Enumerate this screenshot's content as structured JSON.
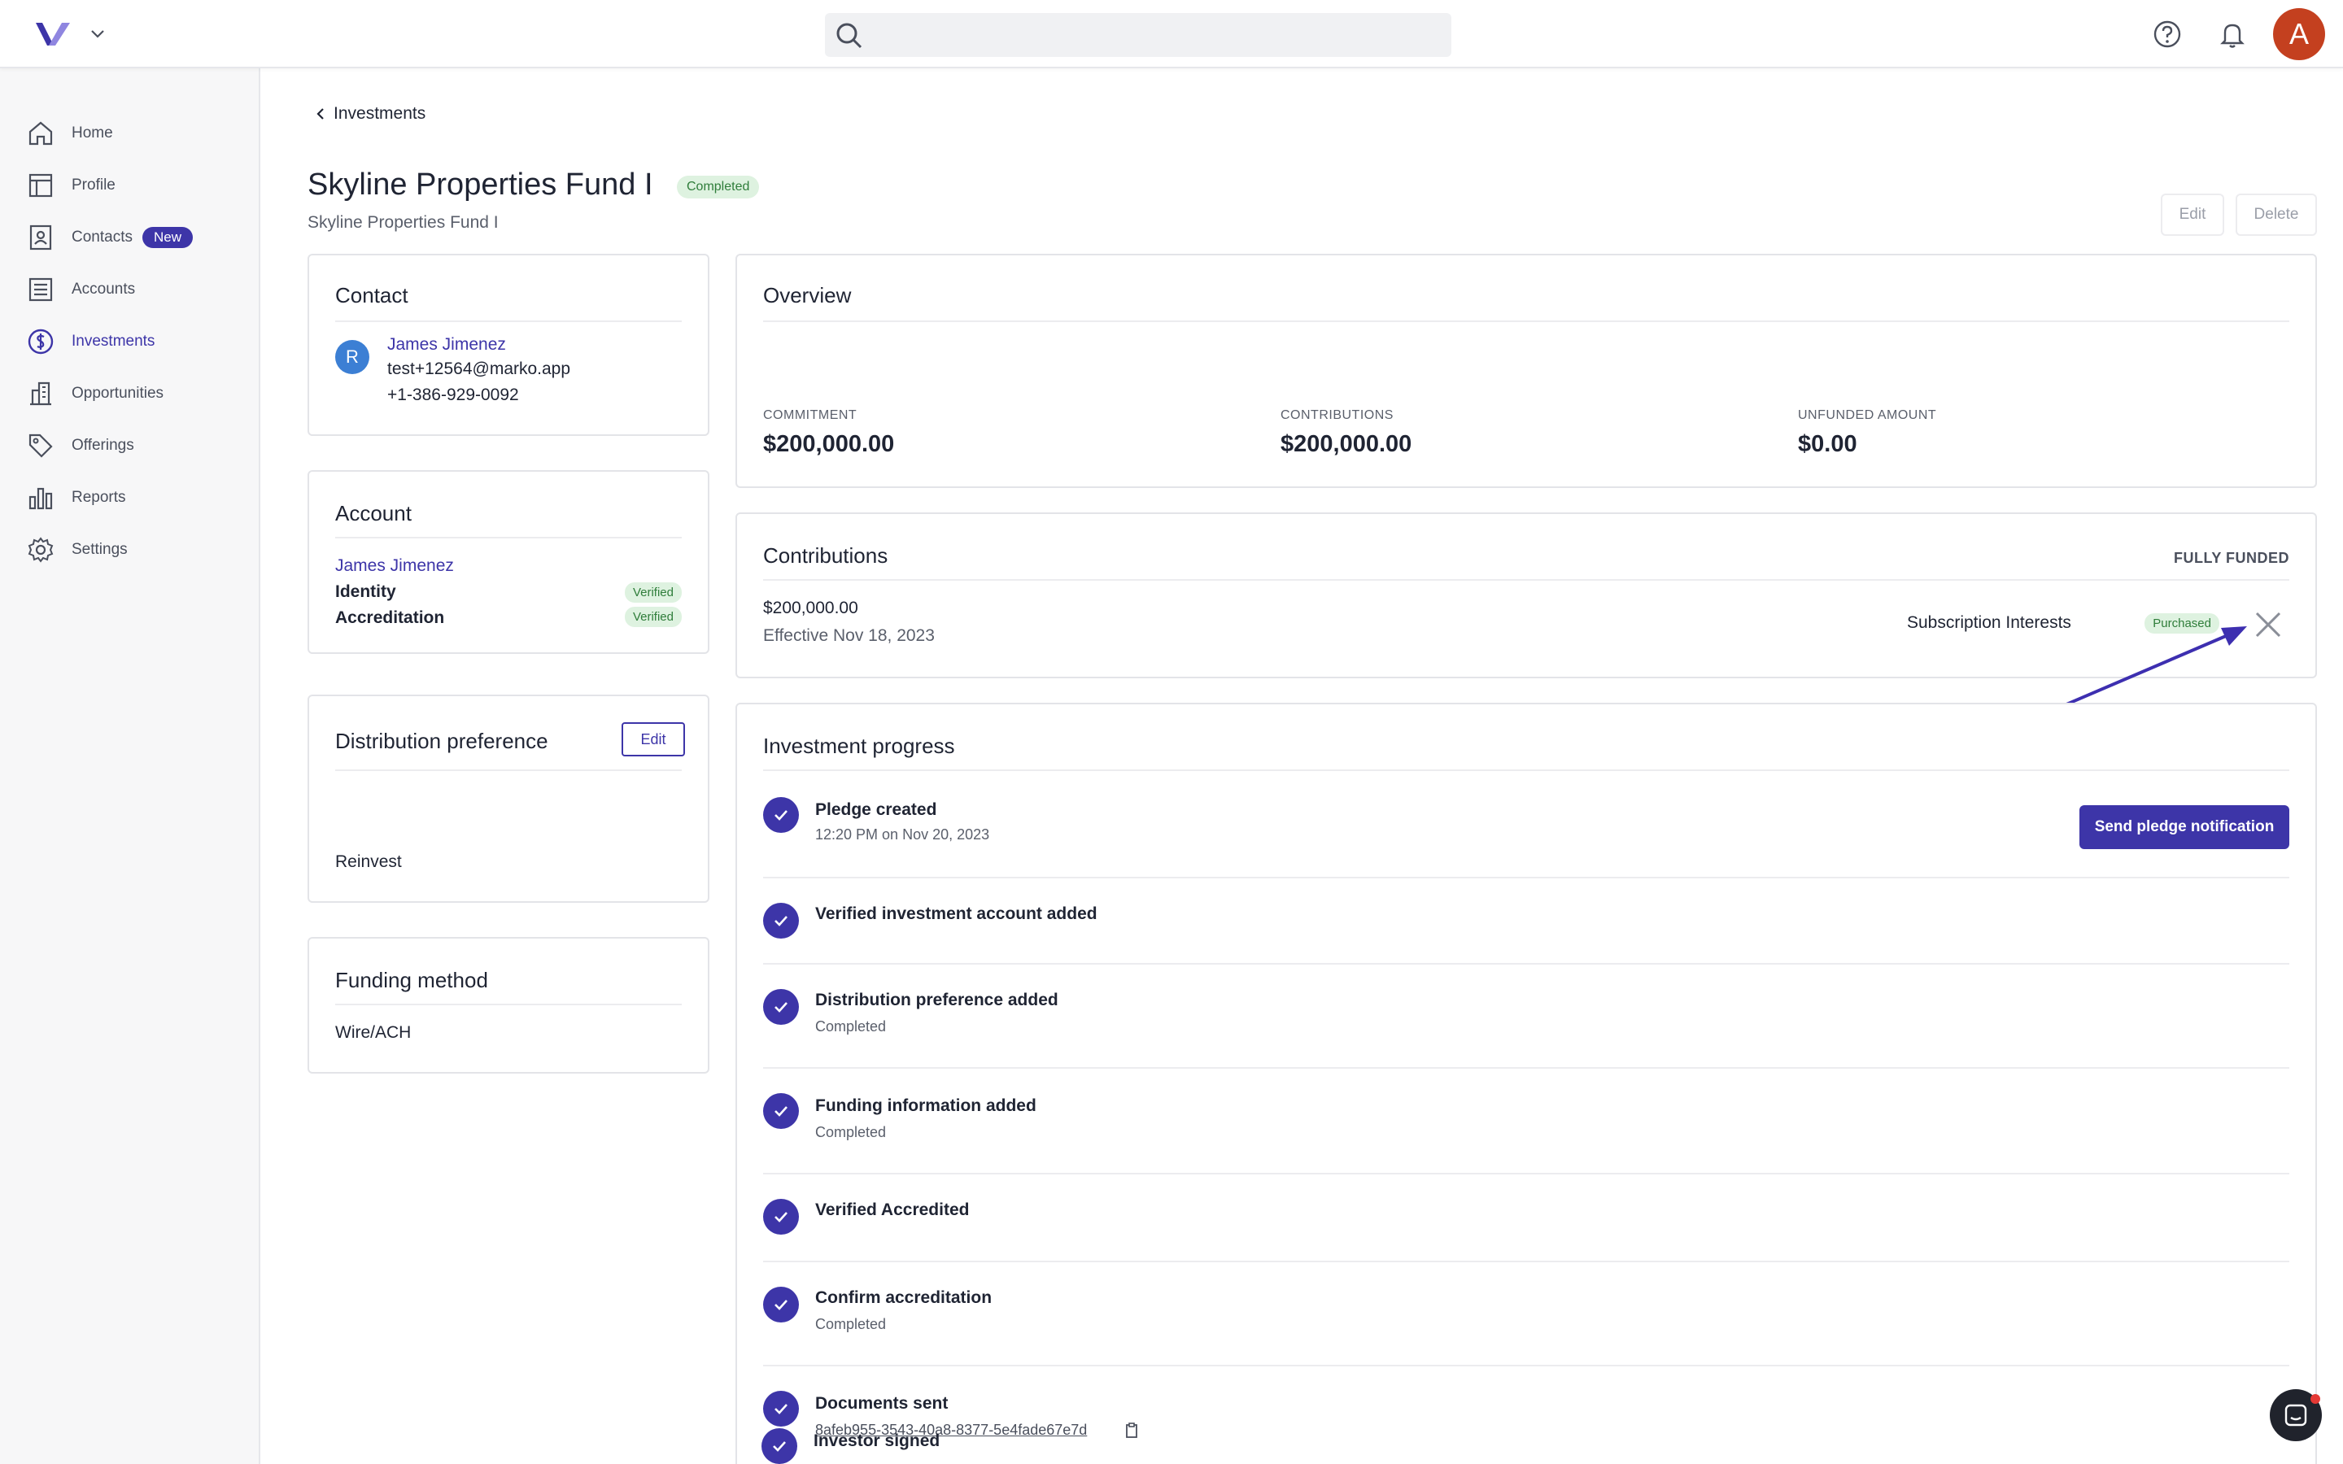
{
  "nav": {
    "items": [
      {
        "label": "Home"
      },
      {
        "label": "Profile"
      },
      {
        "label": "Contacts",
        "badge": "New"
      },
      {
        "label": "Accounts"
      },
      {
        "label": "Investments"
      },
      {
        "label": "Opportunities"
      },
      {
        "label": "Offerings"
      },
      {
        "label": "Reports"
      },
      {
        "label": "Settings"
      }
    ]
  },
  "topbar": {
    "avatar_initial": "A"
  },
  "page": {
    "breadcrumb": "Investments",
    "title": "Skyline Properties Fund I",
    "status_badge": "Completed",
    "subtitle": "Skyline Properties Fund I",
    "edit_label": "Edit",
    "delete_label": "Delete"
  },
  "contact": {
    "title": "Contact",
    "initial": "R",
    "name": "James Jimenez",
    "email": "test+12564@marko.app",
    "phone": "+1-386-929-0092"
  },
  "account": {
    "title": "Account",
    "name": "James Jimenez",
    "identity_label": "Identity",
    "identity_status": "Verified",
    "accreditation_label": "Accreditation",
    "accreditation_status": "Verified"
  },
  "distribution": {
    "title": "Distribution preference",
    "edit_label": "Edit",
    "value": "Reinvest"
  },
  "funding": {
    "title": "Funding method",
    "value": "Wire/ACH"
  },
  "overview": {
    "title": "Overview",
    "commitment_label": "COMMITMENT",
    "commitment_value": "$200,000.00",
    "contributions_label": "CONTRIBUTIONS",
    "contributions_value": "$200,000.00",
    "unfunded_label": "UNFUNDED AMOUNT",
    "unfunded_value": "$0.00"
  },
  "contributions": {
    "title": "Contributions",
    "status": "FULLY FUNDED",
    "amount": "$200,000.00",
    "effective": "Effective Nov 18, 2023",
    "type": "Subscription Interests",
    "badge": "Purchased"
  },
  "progress": {
    "title": "Investment progress",
    "send_button": "Send pledge notification",
    "steps": [
      {
        "title": "Pledge created",
        "sub": "12:20 PM on Nov 20, 2023"
      },
      {
        "title": "Verified investment account added",
        "sub": ""
      },
      {
        "title": "Distribution preference added",
        "sub": "Completed"
      },
      {
        "title": "Funding information added",
        "sub": "Completed"
      },
      {
        "title": "Verified Accredited",
        "sub": ""
      },
      {
        "title": "Confirm accreditation",
        "sub": "Completed"
      },
      {
        "title": "Documents sent",
        "sub": "8afeb955-3543-40a8-8377-5e4fade67e7d"
      },
      {
        "title": "Investor signed",
        "sub": ""
      }
    ]
  },
  "colors": {
    "accent": "#3d35a8",
    "avatar": "#c4401f",
    "success_bg": "#def2e0",
    "success_text": "#2f7d3a"
  }
}
